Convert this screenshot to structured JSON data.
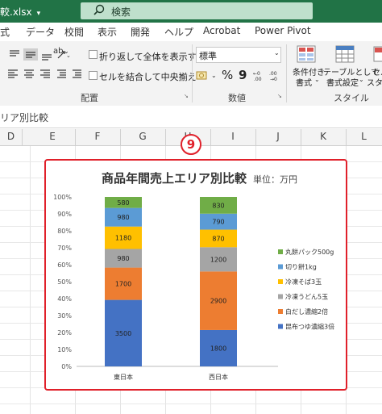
{
  "titlebar": {
    "filename": "較.xlsx",
    "search_placeholder": "検索"
  },
  "tabs": [
    "式",
    "データ",
    "校閲",
    "表示",
    "開発",
    "ヘルプ",
    "Acrobat",
    "Power Pivot"
  ],
  "ribbon": {
    "wrap_text": "折り返して全体を表示する",
    "merge_center": "セルを結合して中央揃え",
    "align_group": "配置",
    "number_format": "標準",
    "percent_symbol": "%",
    "comma_symbol": "9",
    "number_group": "数値",
    "conditional_format_line1": "条件付き",
    "conditional_format_line2": "書式",
    "table_format_line1": "テーブルとして",
    "table_format_line2": "書式設定",
    "cell_style_line1": "セル",
    "cell_style_line2": "スタイ",
    "style_group": "スタイル"
  },
  "formula_bar": {
    "text": "リア別比較"
  },
  "columns": [
    "D",
    "E",
    "F",
    "G",
    "H",
    "I",
    "J",
    "K",
    "L"
  ],
  "chart_badge": "9",
  "colors": {
    "title_bar": "#217346",
    "highlight_border": "#e0202a",
    "series": [
      "#4472c4",
      "#ed7d31",
      "#a5a5a5",
      "#ffc000",
      "#5b9bd5",
      "#70ad47"
    ]
  },
  "chart_data": {
    "type": "bar",
    "stacked": "percent",
    "title": "商品年間売上エリア別比較",
    "unit_label": "単位：万円",
    "categories": [
      "東日本",
      "西日本"
    ],
    "series": [
      {
        "name": "昆布つゆ濃縮3倍",
        "values": [
          3500,
          1800
        ]
      },
      {
        "name": "白だし濃縮2倍",
        "values": [
          1700,
          2900
        ]
      },
      {
        "name": "冷凍うどん5玉",
        "values": [
          980,
          1200
        ]
      },
      {
        "name": "冷凍そば3玉",
        "values": [
          1180,
          870
        ]
      },
      {
        "name": "切り餅1kg",
        "values": [
          980,
          790
        ]
      },
      {
        "name": "丸餅パック500g",
        "values": [
          580,
          830
        ]
      }
    ],
    "y_ticks": [
      "0%",
      "10%",
      "20%",
      "30%",
      "40%",
      "50%",
      "60%",
      "70%",
      "80%",
      "90%",
      "100%"
    ],
    "ylim": [
      0,
      100
    ],
    "grid": false,
    "legend": "right"
  }
}
